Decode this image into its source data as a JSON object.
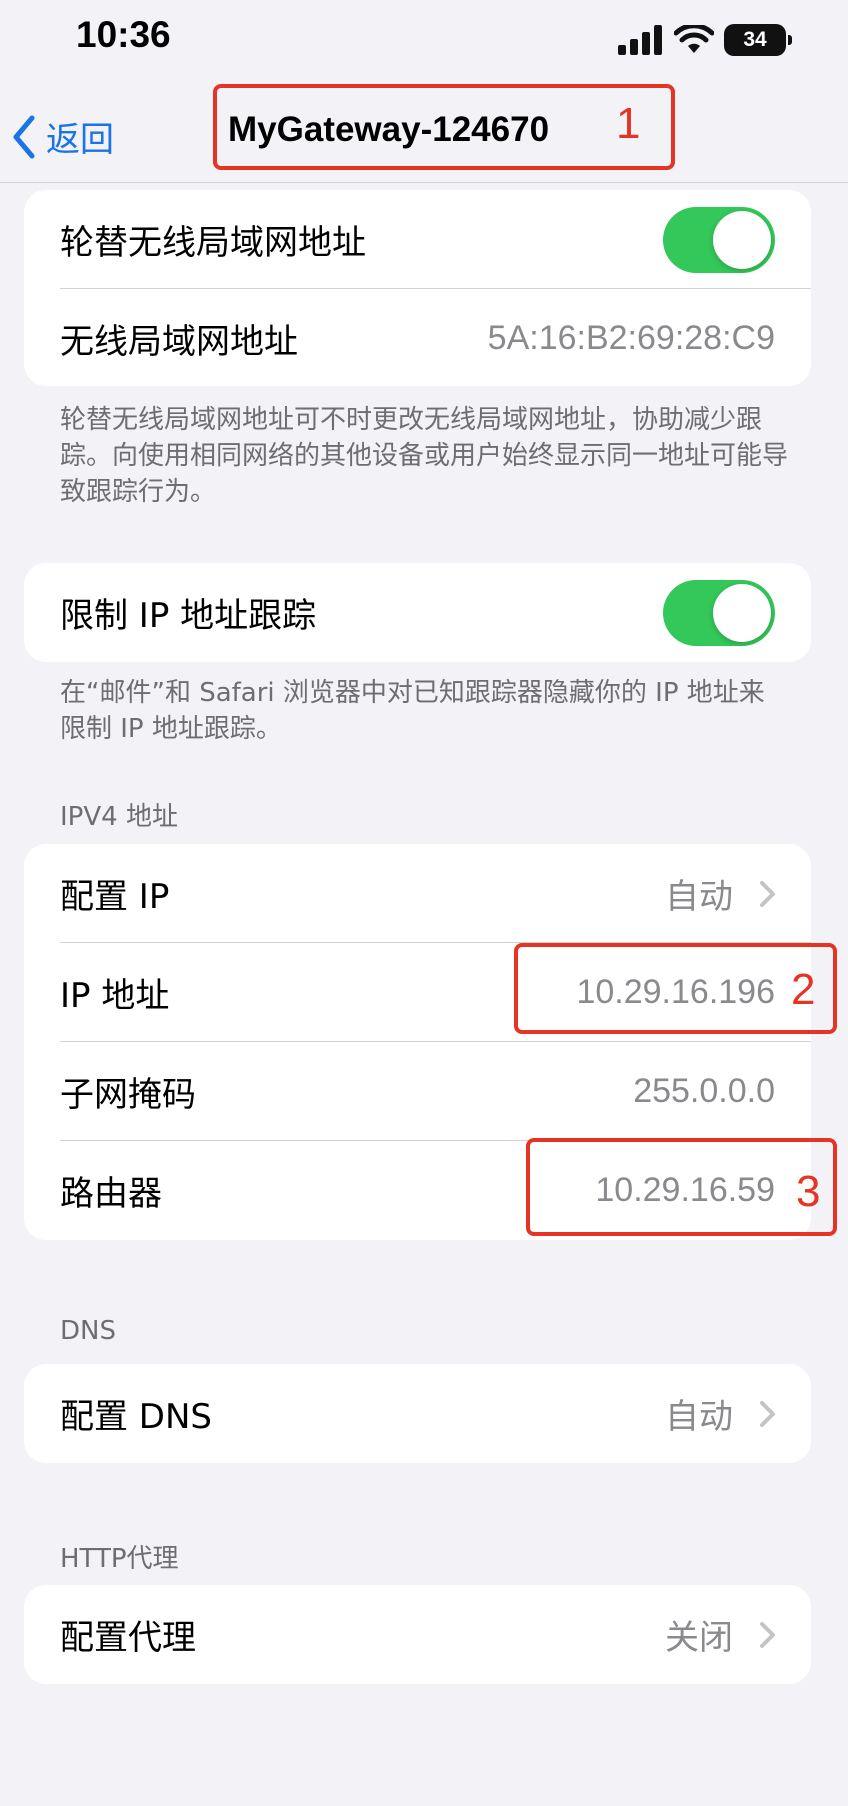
{
  "status_bar": {
    "time": "10:36",
    "battery": "34"
  },
  "nav": {
    "back_label": "返回",
    "title": "MyGateway-124670"
  },
  "annotations": [
    "1",
    "2",
    "3"
  ],
  "wifi_address_card": {
    "rotate_label": "轮替无线局域网地址",
    "rotate_on": true,
    "address_label": "无线局域网地址",
    "address_value": "5A:16:B2:69:28:C9"
  },
  "wifi_address_note": "轮替无线局域网地址可不时更改无线局域网地址，协助减少跟踪。向使用相同网络的其他设备或用户始终显示同一地址可能导致跟踪行为。",
  "limit_ip_card": {
    "label": "限制 IP 地址跟踪",
    "on": true
  },
  "limit_ip_note": "在“邮件”和 Safari 浏览器中对已知跟踪器隐藏你的 IP 地址来限制 IP 地址跟踪。",
  "ipv4": {
    "header": "IPV4 地址",
    "rows": [
      {
        "label": "配置 IP",
        "value": "自动"
      },
      {
        "label": "IP 地址",
        "value": "10.29.16.196"
      },
      {
        "label": "子网掩码",
        "value": "255.0.0.0"
      },
      {
        "label": "路由器",
        "value": "10.29.16.59"
      }
    ]
  },
  "dns": {
    "header": "DNS",
    "label": "配置 DNS",
    "value": "自动"
  },
  "http_proxy": {
    "header": "HTTP代理",
    "label": "配置代理",
    "value": "关闭"
  },
  "colors": {
    "accent": "#1a73e8",
    "toggle_on": "#34c759",
    "annotation": "#e53424"
  }
}
